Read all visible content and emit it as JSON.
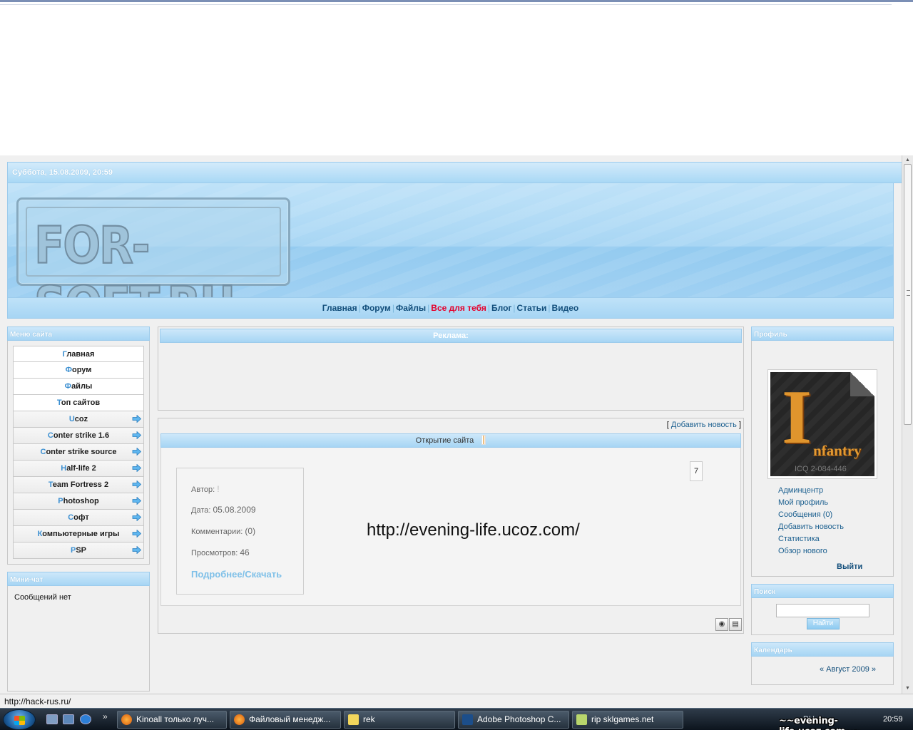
{
  "header": {
    "date": "Суббота, 15.08.2009, 20:59",
    "logo": "FOR-SOFT.RU",
    "nav": [
      {
        "label": "Главная",
        "hot": false
      },
      {
        "label": "Форум",
        "hot": false
      },
      {
        "label": "Файлы",
        "hot": false
      },
      {
        "label": "Все для тебя",
        "hot": true
      },
      {
        "label": "Блог",
        "hot": false
      },
      {
        "label": "Статьи",
        "hot": false
      },
      {
        "label": "Видео",
        "hot": false
      }
    ]
  },
  "sidebar": {
    "menu_title": "Меню сайта",
    "items": [
      {
        "first": "Г",
        "rest": "лавная",
        "submenu": false
      },
      {
        "first": "Ф",
        "rest": "орум",
        "submenu": false
      },
      {
        "first": "Ф",
        "rest": "айлы",
        "submenu": false
      },
      {
        "first": "Т",
        "rest": "оп сайтов",
        "submenu": false
      },
      {
        "first": "U",
        "rest": "coz",
        "submenu": true
      },
      {
        "first": "C",
        "rest": "onter strike 1.6",
        "submenu": true
      },
      {
        "first": "C",
        "rest": "onter strike source",
        "submenu": true
      },
      {
        "first": "H",
        "rest": "alf-life 2",
        "submenu": true
      },
      {
        "first": "T",
        "rest": "eam Fortress 2",
        "submenu": true
      },
      {
        "first": "P",
        "rest": "hotoshop",
        "submenu": true
      },
      {
        "first": "С",
        "rest": "офт",
        "submenu": true
      },
      {
        "first": "К",
        "rest": "омпьютерные игры",
        "submenu": true
      },
      {
        "first": "P",
        "rest": "SP",
        "submenu": true
      }
    ],
    "minichat_title": "Мини-чат",
    "minichat_text": "Сообщений нет"
  },
  "main": {
    "ad_title": "Реклама:",
    "add_news_open": "[",
    "add_news": "Добавить новость",
    "add_news_close": "]",
    "news_title": "Открытие сайта",
    "author_label": "Автор:",
    "author_value": "!",
    "date_label": "Дата:",
    "date_value": "05.08.2009",
    "comments_label": "Комментарии:",
    "comments_value": "(0)",
    "views_label": "Просмотров:",
    "views_value": "46",
    "more_link": "Подробнее/Скачать",
    "counter": "7",
    "url_text": "http://evening-life.ucoz.com/"
  },
  "right": {
    "profile_title": "Профиль",
    "avatar_big": "I",
    "avatar_rest": "nfantry",
    "avatar_icq": "ICQ 2-084-446",
    "links": [
      "Админцентр",
      "Мой профиль",
      "Сообщения (0)",
      "Добавить новость",
      "Статистика",
      "Обзор нового"
    ],
    "logout": "Выйти",
    "search_title": "Поиск",
    "search_button": "Найти",
    "calendar_title": "Календарь",
    "calendar_month": "«  Август 2009  »"
  },
  "status": {
    "url": "http://hack-rus.ru/"
  },
  "taskbar": {
    "tasks": [
      "Kinoall только луч...",
      "Файловый менедж...",
      "rek",
      "Adobe Photoshop C...",
      "rip sklgames.net"
    ],
    "lang": "RU",
    "time": "20:59"
  },
  "watermark": "~~evening-life.ucoz.com~~"
}
